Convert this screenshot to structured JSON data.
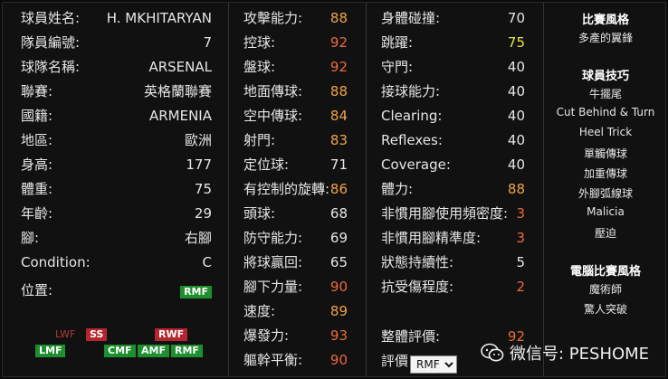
{
  "player": {
    "rows": [
      {
        "label": "球員姓名:",
        "value": "H. MKHITARYAN"
      },
      {
        "label": "隊員編號:",
        "value": "7"
      },
      {
        "label": "球隊名稱:",
        "value": "ARSENAL"
      },
      {
        "label": "聯賽:",
        "value": "英格蘭聯賽"
      },
      {
        "label": "國籍:",
        "value": "ARMENIA"
      },
      {
        "label": "地區:",
        "value": "歐洲"
      },
      {
        "label": "身高:",
        "value": "177"
      },
      {
        "label": "體重:",
        "value": "75"
      },
      {
        "label": "年齡:",
        "value": "29"
      },
      {
        "label": "腳:",
        "value": "右腳"
      },
      {
        "label": "Condition:",
        "value": "C"
      }
    ],
    "position_label": "位置:",
    "position_value": "RMF"
  },
  "position_map": {
    "faint": [
      "LWF"
    ],
    "secondary": [
      "SS",
      "RWF"
    ],
    "primary": [
      "LMF",
      "CMF",
      "AMF",
      "RMF"
    ]
  },
  "stats_col2": [
    {
      "label": "攻擊能力:",
      "value": "88",
      "color": "#f2a347"
    },
    {
      "label": "控球:",
      "value": "92",
      "color": "#ea6a3d"
    },
    {
      "label": "盤球:",
      "value": "92",
      "color": "#ea6a3d"
    },
    {
      "label": "地面傳球:",
      "value": "88",
      "color": "#f2a347"
    },
    {
      "label": "空中傳球:",
      "value": "84",
      "color": "#f2a347"
    },
    {
      "label": "射門:",
      "value": "83",
      "color": "#f2a347"
    },
    {
      "label": "定位球:",
      "value": "71",
      "color": "#e6e6e6"
    },
    {
      "label": "有控制的旋轉:",
      "value": "86",
      "color": "#f2a347"
    },
    {
      "label": "頭球:",
      "value": "68",
      "color": "#e6e6e6"
    },
    {
      "label": "防守能力:",
      "value": "69",
      "color": "#e6e6e6"
    },
    {
      "label": "將球贏回:",
      "value": "65",
      "color": "#e6e6e6"
    },
    {
      "label": "腳下力量:",
      "value": "90",
      "color": "#ea6a3d"
    },
    {
      "label": "速度:",
      "value": "89",
      "color": "#f2a347"
    },
    {
      "label": "爆發力:",
      "value": "93",
      "color": "#ea6a3d"
    },
    {
      "label": "軀幹平衡:",
      "value": "90",
      "color": "#ea6a3d"
    }
  ],
  "stats_col3": [
    {
      "label": "身體碰撞:",
      "value": "70",
      "color": "#e6e6e6"
    },
    {
      "label": "跳躍:",
      "value": "75",
      "color": "#e6e84a"
    },
    {
      "label": "守門:",
      "value": "40",
      "color": "#e6e6e6"
    },
    {
      "label": "接球能力:",
      "value": "40",
      "color": "#e6e6e6"
    },
    {
      "label": "Clearing:",
      "value": "40",
      "color": "#e6e6e6"
    },
    {
      "label": "Reflexes:",
      "value": "40",
      "color": "#e6e6e6"
    },
    {
      "label": "Coverage:",
      "value": "40",
      "color": "#e6e6e6"
    },
    {
      "label": "體力:",
      "value": "88",
      "color": "#f2a347"
    },
    {
      "label": "非慣用腳使用頻密度:",
      "value": "3",
      "color": "#ea6a3d"
    },
    {
      "label": "非慣用腳精準度:",
      "value": "3",
      "color": "#ea6a3d"
    },
    {
      "label": "狀態持續性:",
      "value": "5",
      "color": "#e6e6e6"
    },
    {
      "label": "抗受傷程度:",
      "value": "2",
      "color": "#ea6a3d"
    }
  ],
  "rating": {
    "overall_label": "整體評價:",
    "overall_value": "92",
    "overall_color": "#ea6a3d",
    "eval_label": "評價",
    "eval_selected": "RMF"
  },
  "styles": {
    "play_style_title": "比賽風格",
    "play_style": "多產的翼鋒",
    "skills_title": "球員技巧",
    "skills": [
      "牛擺尾",
      "Cut Behind & Turn",
      "Heel Trick",
      "單觸傳球",
      "加重傳球",
      "外腳弧線球",
      "Malicia",
      "壓迫"
    ],
    "com_title": "電腦比賽風格",
    "com_styles": [
      "魔術師",
      "驚人突破"
    ]
  },
  "watermark": {
    "icon": "wechat-icon",
    "text": "微信号: PESHOME"
  }
}
